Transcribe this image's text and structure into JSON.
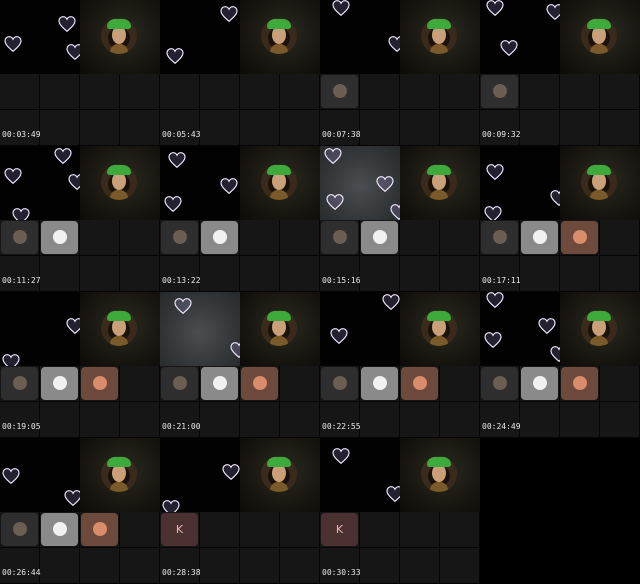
{
  "frames": [
    {
      "timestamp": "00:03:49",
      "thumbs": []
    },
    {
      "timestamp": "00:05:43",
      "thumbs": []
    },
    {
      "timestamp": "00:07:38",
      "thumbs": [
        "cursor"
      ]
    },
    {
      "timestamp": "00:09:32",
      "thumbs": [
        "cursor"
      ]
    },
    {
      "timestamp": "00:11:27",
      "thumbs": [
        "cursor",
        "white"
      ]
    },
    {
      "timestamp": "00:13:22",
      "thumbs": [
        "cursor",
        "white"
      ]
    },
    {
      "timestamp": "00:15:16",
      "thumbs": [
        "cursor",
        "white"
      ],
      "gray": true
    },
    {
      "timestamp": "00:17:11",
      "thumbs": [
        "cursor",
        "white",
        "peach"
      ]
    },
    {
      "timestamp": "00:19:05",
      "thumbs": [
        "cursor",
        "white",
        "peach"
      ]
    },
    {
      "timestamp": "00:21:00",
      "thumbs": [
        "cursor",
        "white",
        "peach"
      ],
      "gray": true
    },
    {
      "timestamp": "00:22:55",
      "thumbs": [
        "cursor",
        "white",
        "peach"
      ]
    },
    {
      "timestamp": "00:24:49",
      "thumbs": [
        "cursor",
        "white",
        "peach"
      ]
    },
    {
      "timestamp": "00:26:44",
      "thumbs": [
        "cursor",
        "white",
        "peach"
      ]
    },
    {
      "timestamp": "00:28:38",
      "thumbs": [
        "K"
      ]
    },
    {
      "timestamp": "00:30:33",
      "thumbs": [
        "K"
      ]
    }
  ]
}
